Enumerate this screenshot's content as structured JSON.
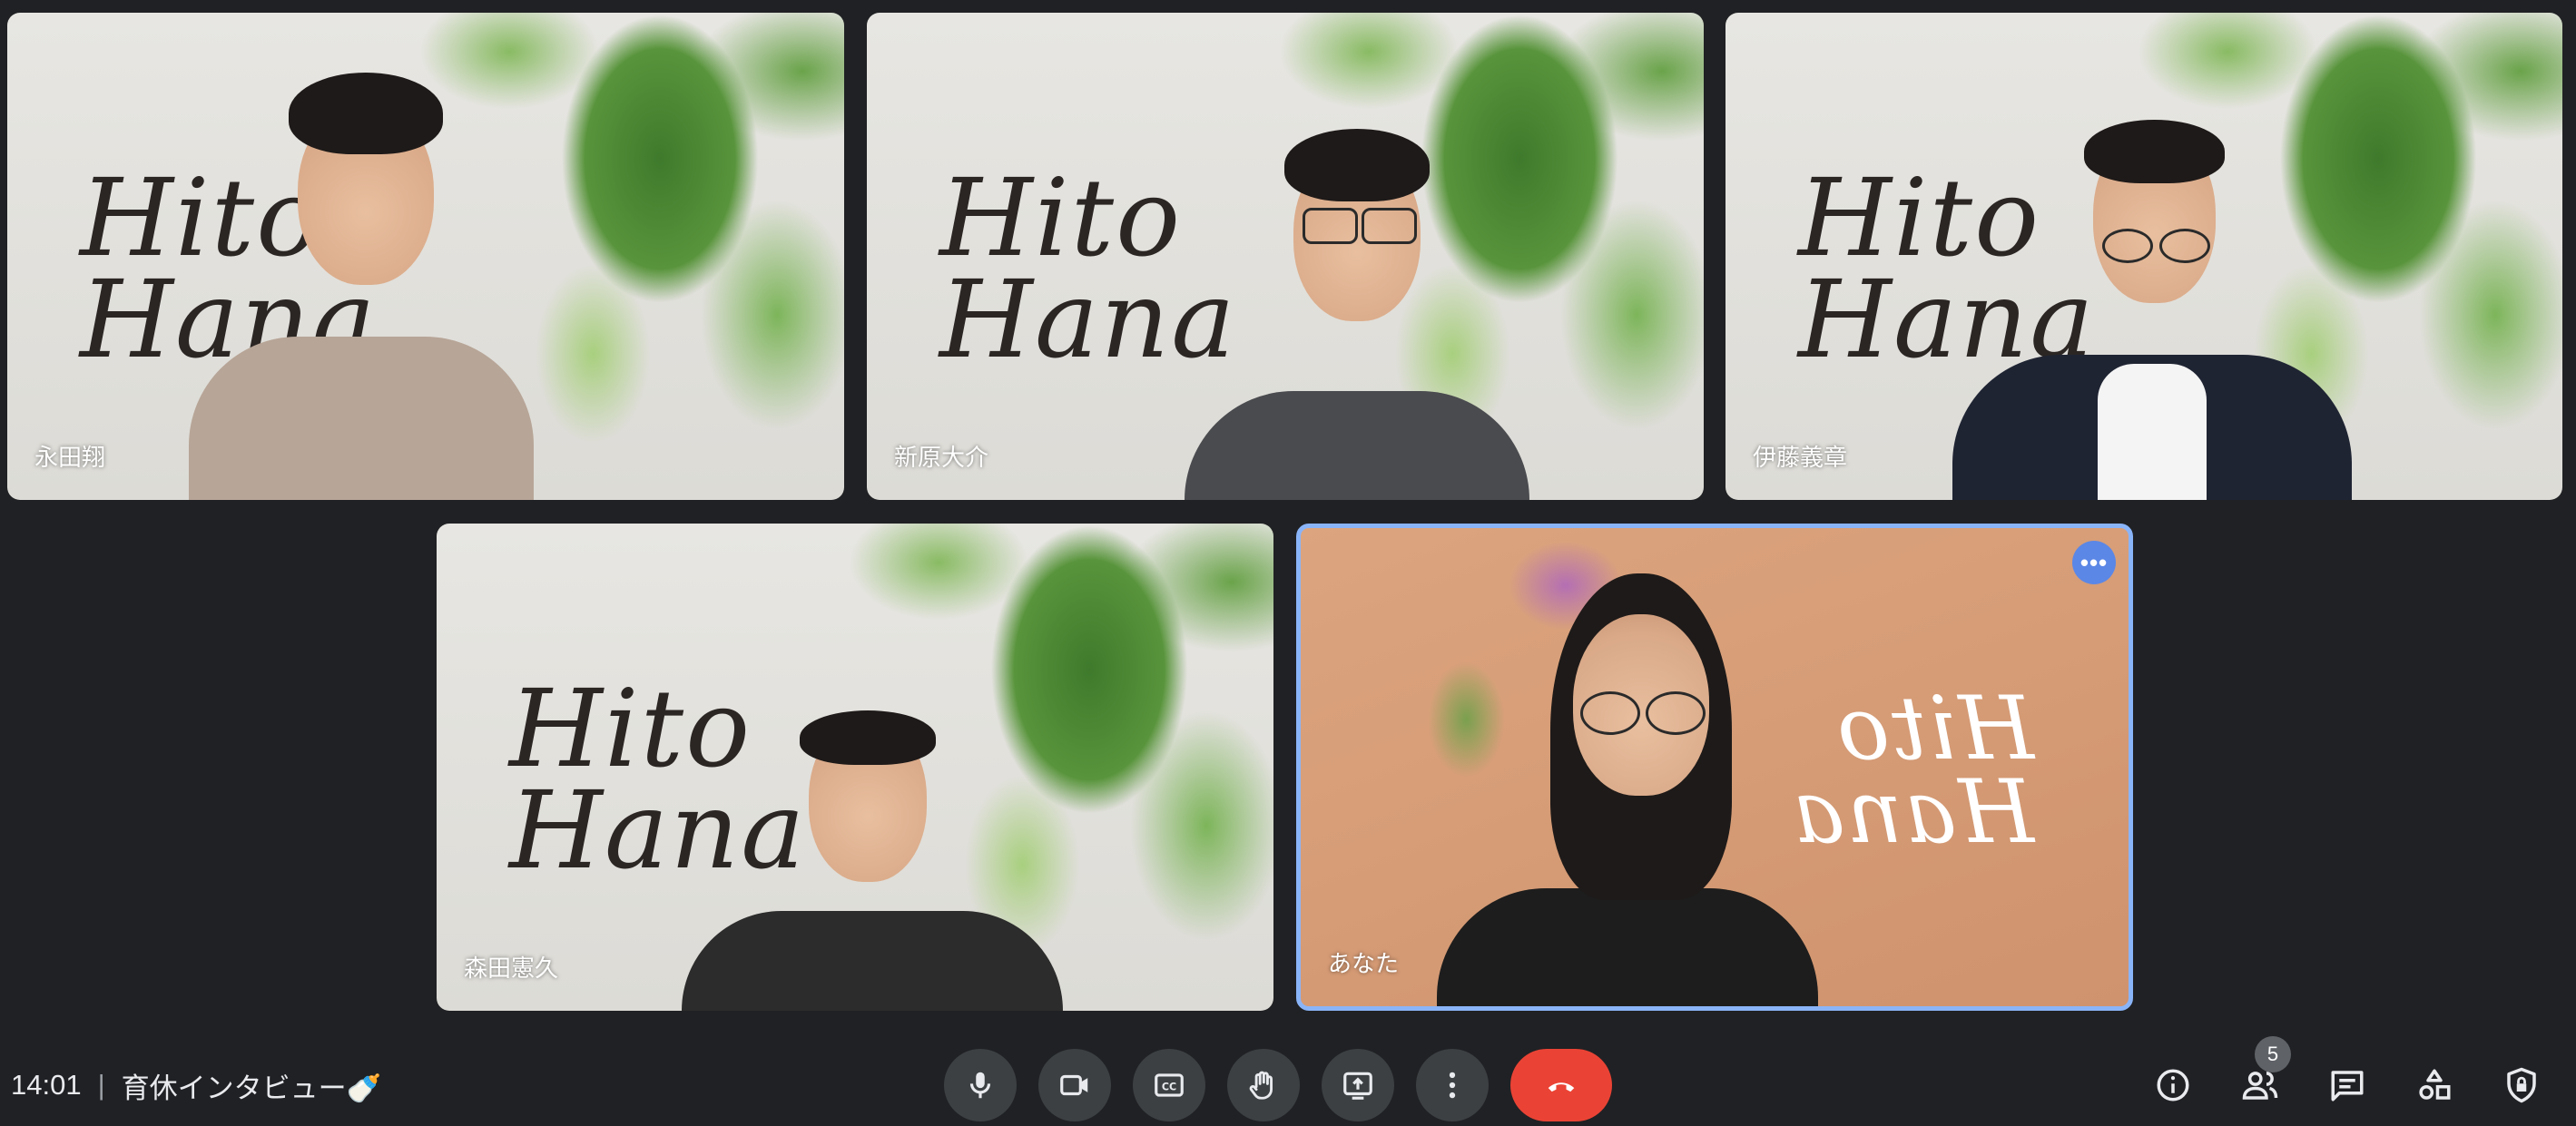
{
  "meeting": {
    "time": "14:01",
    "separator": "|",
    "title": "育休インタビュー🍼"
  },
  "logo": {
    "line1": "Hito",
    "line2": "Hana"
  },
  "participants": [
    {
      "name": "永田翔"
    },
    {
      "name": "新原大介"
    },
    {
      "name": "伊藤義章"
    },
    {
      "name": "森田憲久"
    },
    {
      "name": "あなた",
      "active": true,
      "menu_icon": "more-horiz-icon"
    }
  ],
  "controls": [
    {
      "icon": "microphone-icon"
    },
    {
      "icon": "camera-icon"
    },
    {
      "icon": "closed-captions-icon"
    },
    {
      "icon": "raise-hand-icon"
    },
    {
      "icon": "present-screen-icon"
    },
    {
      "icon": "more-vert-icon"
    },
    {
      "icon": "end-call-icon",
      "color": "#ea4335"
    }
  ],
  "side_panel": {
    "people_count": "5",
    "icons": [
      "info-icon",
      "people-icon",
      "chat-icon",
      "activities-icon",
      "host-controls-icon"
    ]
  },
  "colors": {
    "background": "#202124",
    "active_border": "#8ab4f8",
    "end_call": "#ea4335"
  }
}
